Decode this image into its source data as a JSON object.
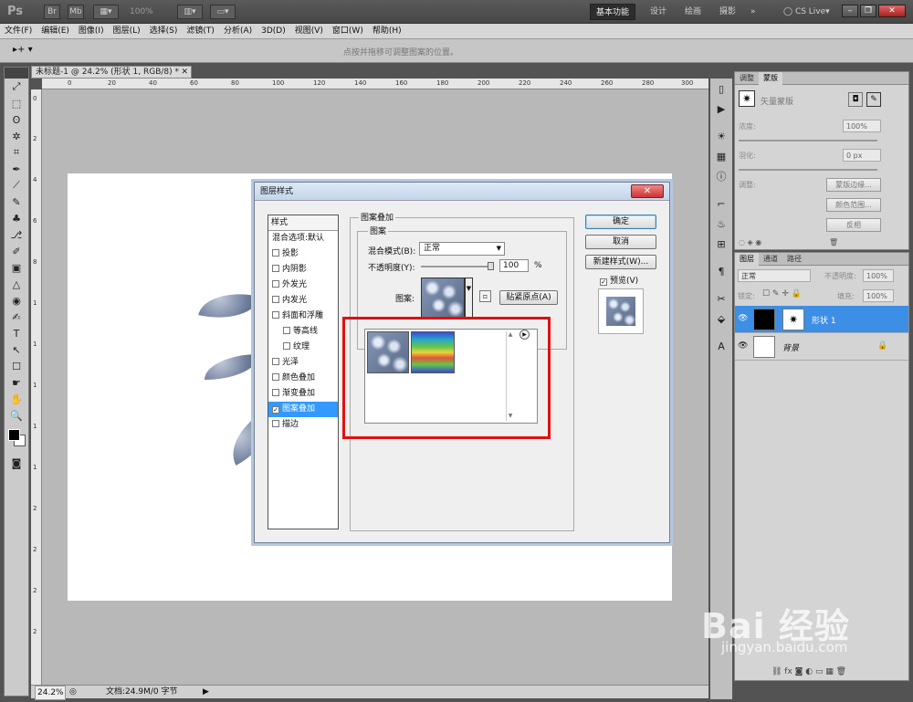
{
  "titlebar": {
    "logo": "Ps",
    "zoom": "100%",
    "workspaces": [
      "基本功能",
      "设计",
      "绘画",
      "摄影"
    ],
    "more": "»",
    "cslive": "CS Live▾",
    "win_min": "–",
    "win_restore": "❐",
    "win_close": "✕"
  },
  "menu": [
    "文件(F)",
    "编辑(E)",
    "图像(I)",
    "图层(L)",
    "选择(S)",
    "滤镜(T)",
    "分析(A)",
    "3D(D)",
    "视图(V)",
    "窗口(W)",
    "帮助(H)"
  ],
  "options": {
    "tool": "▸+ ▾",
    "hint": "点按并拖移可调整图案的位置。"
  },
  "tools": [
    "⤢",
    "⬚",
    "ʘ",
    "✲",
    "⌗",
    "✒",
    "⟋",
    "✎",
    "♣",
    "⎇",
    "✐",
    "▣",
    "△",
    "◉",
    "✍",
    "T",
    "↖",
    "☐",
    "☛",
    "✋",
    "🔍"
  ],
  "document": {
    "tab_title": "未标题-1 @ 24.2% (形状 1, RGB/8) *",
    "tab_close": "✕",
    "ruler_h": [
      "0",
      "20",
      "40",
      "60",
      "80",
      "100",
      "120",
      "140",
      "160",
      "180",
      "200",
      "220",
      "240",
      "260",
      "280",
      "300"
    ],
    "ruler_v": [
      "0",
      "2",
      "4",
      "6",
      "8",
      "1",
      "1",
      "1",
      "1",
      "1",
      "2",
      "2",
      "2",
      "2"
    ],
    "status_zoom": "24.2%",
    "status_doc": "文档:24.9M/0 字节"
  },
  "mask_panel": {
    "tabs": [
      "调整",
      "蒙版"
    ],
    "mask_label": "矢量蒙版",
    "density_label": "浓度:",
    "density_value": "100%",
    "feather_label": "羽化:",
    "feather_value": "0 px",
    "adjust_label": "调整:",
    "buttons": [
      "蒙版边缘...",
      "颜色范围...",
      "反相"
    ]
  },
  "layers_panel": {
    "tabs": [
      "图层",
      "通道",
      "路径"
    ],
    "blend_mode": "正常",
    "opacity_label": "不透明度:",
    "opacity_value": "100%",
    "lock_label": "锁定:",
    "fill_label": "填充:",
    "fill_value": "100%",
    "layers": [
      {
        "name": "形状 1",
        "selected": true
      },
      {
        "name": "背景",
        "selected": false,
        "lock": "🔒"
      }
    ]
  },
  "dialog": {
    "title": "图层样式",
    "close": "✕",
    "styles_header": "样式",
    "styles": [
      {
        "label": "混合选项:默认",
        "checkbox": false,
        "sub": false,
        "checked": false,
        "selected": false
      },
      {
        "label": "投影",
        "checkbox": true,
        "sub": false,
        "checked": false,
        "selected": false
      },
      {
        "label": "内阴影",
        "checkbox": true,
        "sub": false,
        "checked": false,
        "selected": false
      },
      {
        "label": "外发光",
        "checkbox": true,
        "sub": false,
        "checked": false,
        "selected": false
      },
      {
        "label": "内发光",
        "checkbox": true,
        "sub": false,
        "checked": false,
        "selected": false
      },
      {
        "label": "斜面和浮雕",
        "checkbox": true,
        "sub": false,
        "checked": false,
        "selected": false
      },
      {
        "label": "等高线",
        "checkbox": true,
        "sub": true,
        "checked": false,
        "selected": false
      },
      {
        "label": "纹理",
        "checkbox": true,
        "sub": true,
        "checked": false,
        "selected": false
      },
      {
        "label": "光泽",
        "checkbox": true,
        "sub": false,
        "checked": false,
        "selected": false
      },
      {
        "label": "颜色叠加",
        "checkbox": true,
        "sub": false,
        "checked": false,
        "selected": false
      },
      {
        "label": "渐变叠加",
        "checkbox": true,
        "sub": false,
        "checked": false,
        "selected": false
      },
      {
        "label": "图案叠加",
        "checkbox": true,
        "sub": false,
        "checked": true,
        "selected": true
      },
      {
        "label": "描边",
        "checkbox": true,
        "sub": false,
        "checked": false,
        "selected": false
      }
    ],
    "group_title": "图案叠加",
    "inner_title": "图案",
    "blend_label": "混合模式(B):",
    "blend_value": "正常",
    "opacity_label": "不透明度(Y):",
    "opacity_value": "100",
    "opacity_unit": "%",
    "pattern_label": "图案:",
    "snap_button": "贴紧原点(A)",
    "ok": "确定",
    "cancel": "取消",
    "new_style": "新建样式(W)...",
    "preview_label": "预览(V)"
  },
  "watermark": {
    "brand": "Bai 经验",
    "url": "jingyan.baidu.com"
  }
}
